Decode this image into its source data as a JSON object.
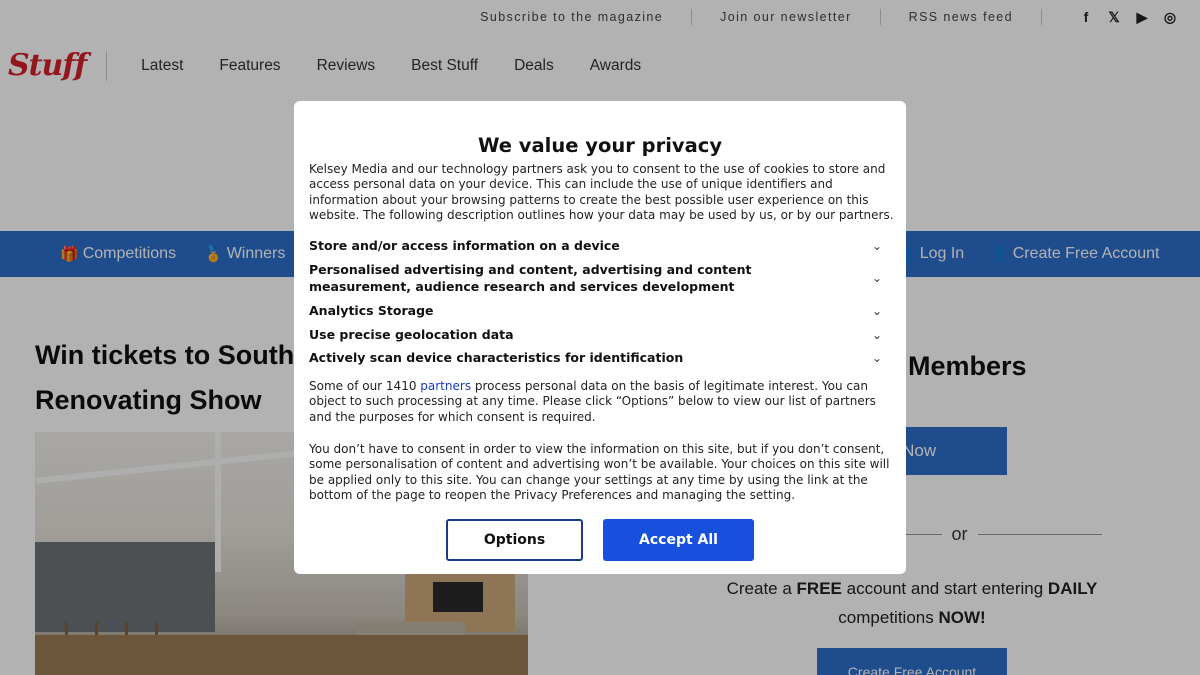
{
  "utility": {
    "links": [
      "Subscribe to the magazine",
      "Join our newsletter",
      "RSS news feed"
    ],
    "social": [
      "f",
      "𝕏",
      "▶",
      "◎"
    ]
  },
  "header": {
    "logo": "Stuff",
    "nav": [
      "Latest",
      "Features",
      "Reviews",
      "Best Stuff",
      "Deals",
      "Awards"
    ]
  },
  "bluebar": {
    "competitions": "Competitions",
    "winners": "Winners",
    "login": "Log In",
    "create_account": "Create Free Account"
  },
  "article": {
    "title": "Win tickets to South\nRenovating Show"
  },
  "sidebar": {
    "members_title": "Members",
    "join_button": "n Now",
    "or": "or",
    "create_prefix": "Create a ",
    "create_free": "FREE",
    "create_mid": " account and start entering ",
    "create_daily": "DAILY",
    "create_line2": "competitions ",
    "create_now": "NOW!",
    "create_button": "Create Free Account"
  },
  "consent": {
    "title": "We value your privacy",
    "intro": "Kelsey Media and our technology partners ask you to consent to the use of cookies to store and access personal data on your device. This can include the use of unique identifiers and information about your browsing patterns to create the best possible user experience on this website. The following description outlines how your data may be used by us, or by our partners.",
    "purposes": [
      "Store and/or access information on a device",
      "Personalised advertising and content, advertising and content measurement, audience research and services development",
      "Analytics Storage",
      "Use precise geolocation data",
      "Actively scan device characteristics for identification"
    ],
    "legit_prefix": "Some of our 1410 ",
    "legit_link": "partners",
    "legit_suffix": " process personal data on the basis of legitimate interest. You can object to such processing at any time. Please click “Options” below to view our list of partners and the purposes for which consent is required.",
    "no_consent": "You don’t have to consent in order to view the information on this site, but if you don’t consent, some personalisation of content and advertising won’t be available. Your choices on this site will be applied only to this site. You can change your settings at any time by using the link at the bottom of the page to reopen the Privacy Preferences and managing the setting.",
    "options_label": "Options",
    "accept_label": "Accept All"
  },
  "colors": {
    "brand_red": "#d4202a",
    "nav_blue": "#2c6ecb",
    "accept_blue": "#1650dc",
    "link_blue": "#1a3ec5"
  }
}
